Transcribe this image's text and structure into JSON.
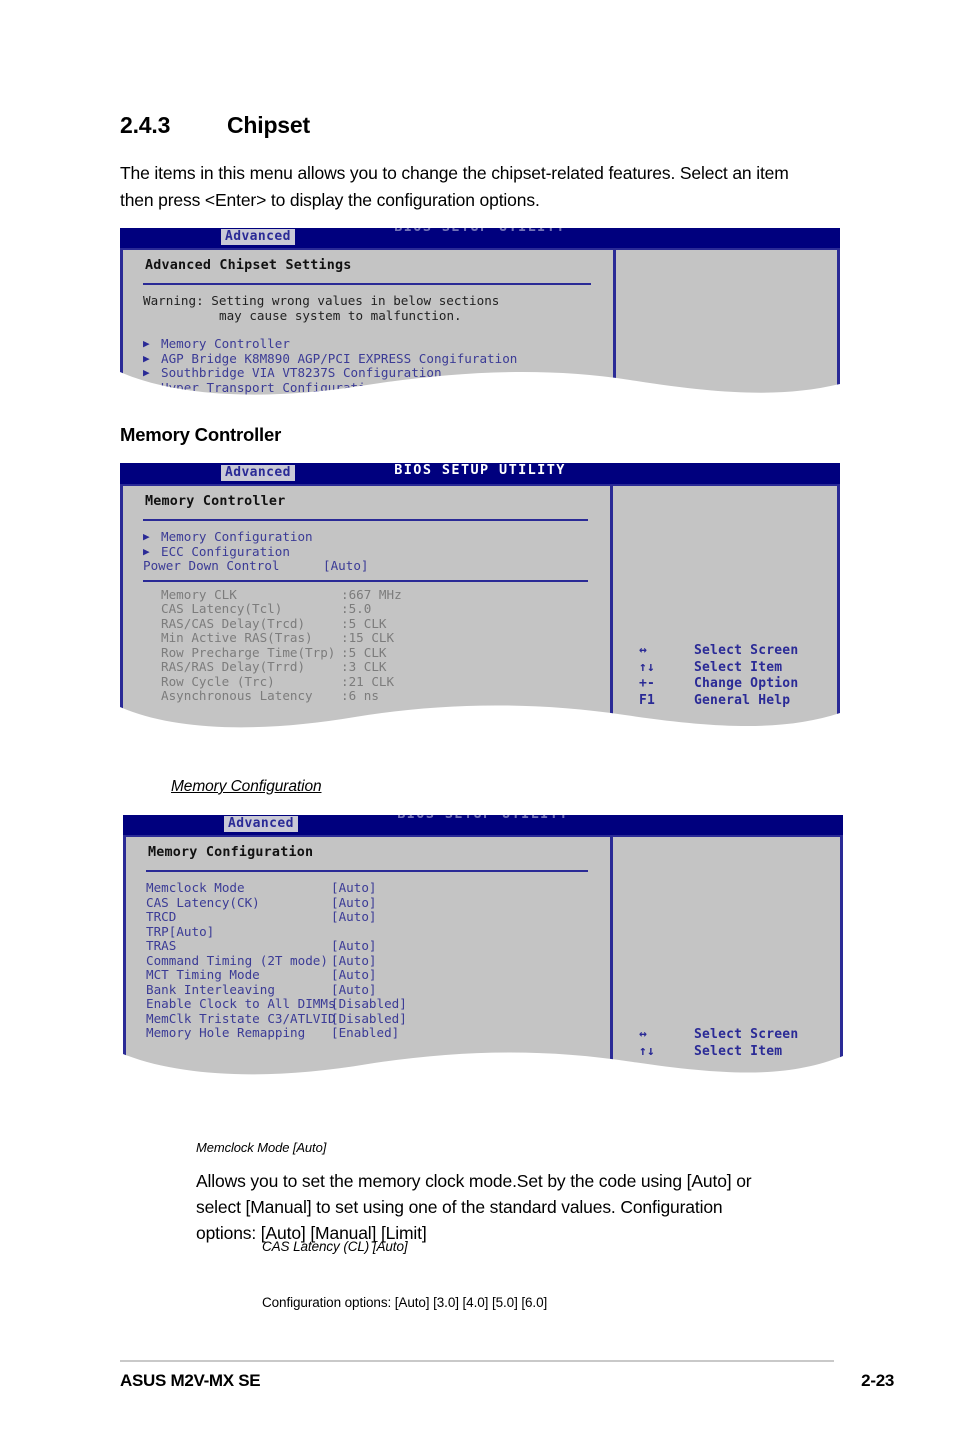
{
  "section": {
    "number": "2.4.3",
    "title": "Chipset",
    "intro": "The items in this menu allows you to change the chipset-related features. Select an item then press <Enter> to display the configuration options."
  },
  "bios_common": {
    "utility_title": "BIOS SETUP UTILITY",
    "tab_label": "Advanced",
    "arrow_glyph": "▶"
  },
  "screen1": {
    "panel_title": "Advanced Chipset Settings",
    "warning_line1": "Warning: Setting wrong values in below sections",
    "warning_line2": "may cause system to malfunction.",
    "menu_items": [
      "Memory Controller",
      "AGP Bridge K8M890 AGP/PCI EXPRESS Congifuration",
      "Southbridge VIA VT8237S Configuration",
      "Hyper Transport Configuration"
    ]
  },
  "heading_memory_controller": "Memory Controller",
  "screen2": {
    "panel_title": "Memory Controller",
    "submenus": [
      "Memory Configuration",
      "ECC Configuration"
    ],
    "setting": {
      "label": "Power Down Control",
      "value": "[Auto]"
    },
    "info_rows": [
      {
        "label": "Memory CLK",
        "value": ":667 MHz"
      },
      {
        "label": "CAS Latency(Tcl)",
        "value": ":5.0"
      },
      {
        "label": "RAS/CAS Delay(Trcd)",
        "value": ":5 CLK"
      },
      {
        "label": "Min Active RAS(Tras)",
        "value": ":15 CLK"
      },
      {
        "label": "Row Precharge Time(Trp)",
        "value": ":5 CLK"
      },
      {
        "label": "RAS/RAS Delay(Trrd)",
        "value": ":3 CLK"
      },
      {
        "label": "Row Cycle (Trc)",
        "value": ":21 CLK"
      },
      {
        "label": "Asynchronous Latency",
        "value": ":6 ns"
      }
    ],
    "hints": [
      {
        "key": "↔",
        "text": "Select Screen"
      },
      {
        "key": "↑↓",
        "text": "Select Item"
      },
      {
        "key": "+-",
        "text": "Change Option"
      },
      {
        "key": "F1",
        "text": "General Help"
      }
    ]
  },
  "heading_memory_configuration": "Memory Configuration",
  "screen3": {
    "panel_title": "Memory Configuration",
    "rows": [
      {
        "label": "Memclock Mode",
        "value": "[Auto]"
      },
      {
        "label": "CAS Latency(CK)",
        "value": "[Auto]"
      },
      {
        "label": "TRCD",
        "value": "[Auto]"
      },
      {
        "label": "TRP[Auto]",
        "value": ""
      },
      {
        "label": "TRAS",
        "value": "[Auto]"
      },
      {
        "label": "Command Timing (2T mode)",
        "value": "[Auto]"
      },
      {
        "label": "MCT Timing Mode",
        "value": "[Auto]"
      },
      {
        "label": "Bank Interleaving",
        "value": "[Auto]"
      },
      {
        "label": "Enable Clock to All DIMMs",
        "value": "[Disabled]"
      },
      {
        "label": "MemClk Tristate C3/ATLVID",
        "value": "[Disabled]"
      },
      {
        "label": "Memory Hole Remapping",
        "value": "[Enabled]"
      }
    ],
    "hints": [
      {
        "key": "↔",
        "text": "Select Screen"
      },
      {
        "key": "↑↓",
        "text": "Select Item"
      }
    ]
  },
  "descriptions": {
    "memclock_title": "Memclock Mode [Auto]",
    "memclock_body": "Allows you to set the memory clock mode.Set by the code using [Auto] or select [Manual] to set using one of the standard values. Configuration options: [Auto] [Manual] [Limit]",
    "cas_title": "CAS Latency (CL) [Auto]",
    "cas_body": "Configuration options: [Auto] [3.0] [4.0] [5.0] [6.0]"
  },
  "footer": {
    "product": "ASUS M2V-MX SE",
    "page": "2-23"
  },
  "colors": {
    "bios_titlebar": "#00007e",
    "bios_background": "#c4c4c4",
    "bios_text_blue": "#3b3b96",
    "bios_text_gray": "#7c7c7c",
    "bios_border": "#2a2a96"
  }
}
